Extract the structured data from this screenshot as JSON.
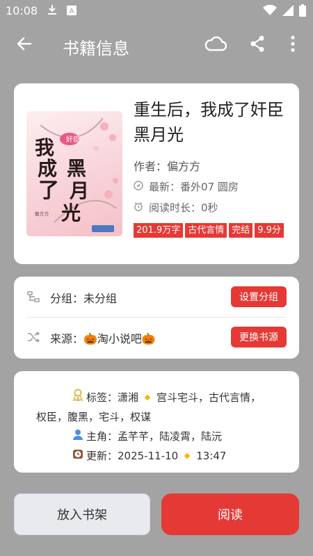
{
  "status": {
    "time": "10:08",
    "icons": [
      "download-icon",
      "a-badge-icon",
      "wifi-icon",
      "signal-icon",
      "battery-icon"
    ]
  },
  "app_bar": {
    "title": "书籍信息",
    "icons": [
      "back-arrow-icon",
      "cloud-icon",
      "share-icon",
      "more-vert-icon"
    ]
  },
  "book": {
    "title": "重生后，我成了奸臣黑月光",
    "author_line": "作者：偏方方",
    "latest_line": "最新：番外07 圆房",
    "read_time_line": "阅读时长：0秒",
    "tags": [
      "201.9万字",
      "古代言情",
      "完结",
      "9.9分"
    ],
    "cover": {
      "big_chars": [
        "我",
        "成",
        "了",
        "黑",
        "月",
        "光"
      ],
      "small_chars": [
        "奸",
        "臣"
      ],
      "author_mark": "偏方方"
    }
  },
  "group_row": {
    "label": "分组：未分组",
    "button": "设置分组"
  },
  "source_row": {
    "label": "来源：🎃淘小说吧🎃",
    "button": "更换书源"
  },
  "details": {
    "tags_label": "标签：潇湘",
    "tags_rest": "宫斗宅斗，古代言情，",
    "tags_line2": "权臣，腹黑，宅斗，权谋",
    "roles_line": "主角：孟芊芊，陆凌霄，陆沅",
    "update_label": "更新：2025-11-10",
    "update_time": "13:47"
  },
  "actions": {
    "shelf": "放入书架",
    "read": "阅读"
  },
  "colors": {
    "accent": "#e53935",
    "background": "#a3a3a3"
  }
}
